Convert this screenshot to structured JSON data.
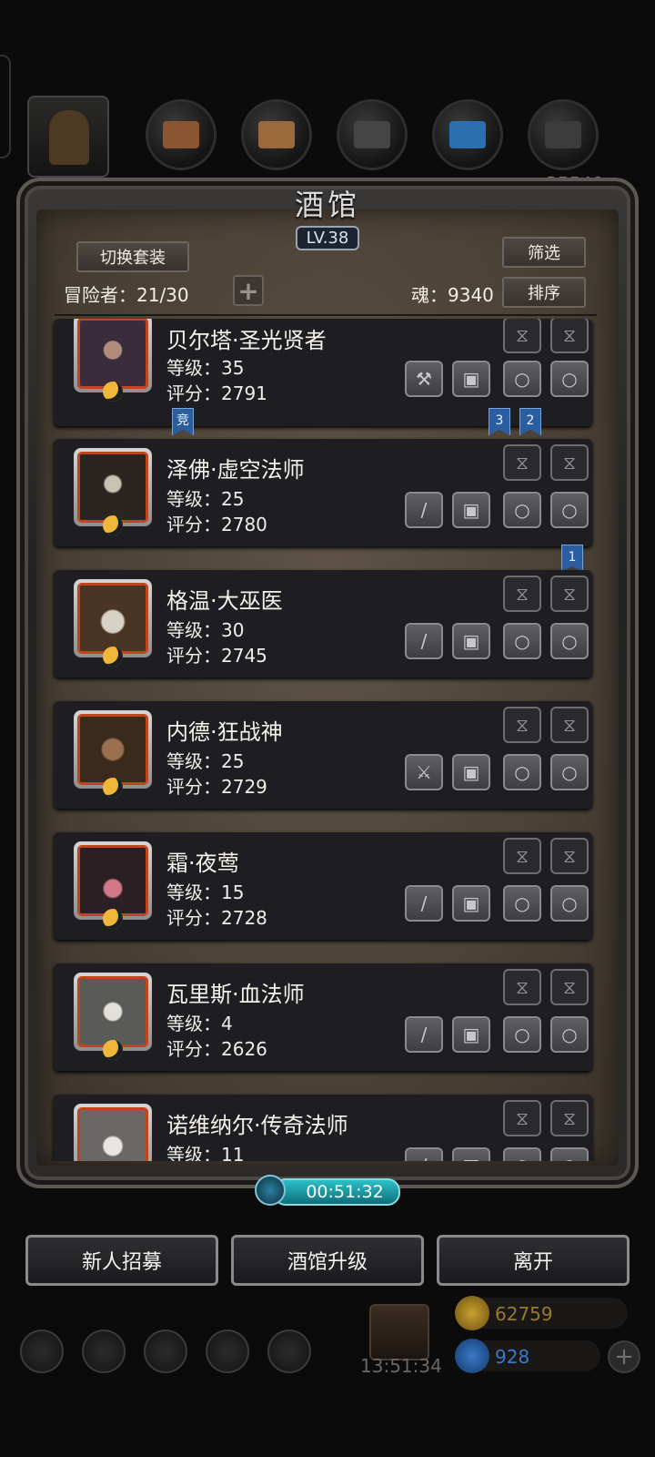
{
  "top_bar": {
    "hidden_value": "35540"
  },
  "panel": {
    "title": "酒馆",
    "level": "LV.38",
    "switch_set_label": "切换套装",
    "filter_label": "筛选",
    "sort_label": "排序",
    "adventurers_text": "冒险者：21/30",
    "soul_text": "魂：9340",
    "plus_symbol": "+"
  },
  "heroes": [
    {
      "name": "贝尔塔·圣光贤者",
      "level": "等级：35",
      "score": "评分：2791",
      "weapon_icon": "hammer-icon",
      "portrait_color": "#3a2b3d",
      "accent": "#b08d7a"
    },
    {
      "name": "泽佛·虚空法师",
      "level": "等级：25",
      "score": "评分：2780",
      "weapon_icon": "staff-icon",
      "portrait_color": "#2a2520",
      "accent": "#c9c2b4"
    },
    {
      "name": "格温·大巫医",
      "level": "等级：30",
      "score": "评分：2745",
      "weapon_icon": "staff-icon",
      "portrait_color": "#4a3524",
      "accent": "#d8d2c4"
    },
    {
      "name": "内德·狂战神",
      "level": "等级：25",
      "score": "评分：2729",
      "weapon_icon": "axe-icon",
      "portrait_color": "#3a2a1c",
      "accent": "#9a7050"
    },
    {
      "name": "霜·夜莺",
      "level": "等级：15",
      "score": "评分：2728",
      "weapon_icon": "dagger-icon",
      "portrait_color": "#2a1f22",
      "accent": "#d2788a"
    },
    {
      "name": "瓦里斯·血法师",
      "level": "等级：4",
      "score": "评分：2626",
      "weapon_icon": "staff-icon",
      "portrait_color": "#5a5a58",
      "accent": "#e4e1da"
    },
    {
      "name": "诺维纳尔·传奇法师",
      "level": "等级：11",
      "score": "",
      "weapon_icon": "staff-icon",
      "portrait_color": "#6a6866",
      "accent": "#e8e6e0"
    }
  ],
  "flags": {
    "arena": "竞",
    "rank3": "3",
    "rank2": "2",
    "rank1": "1"
  },
  "timer": "00:51:32",
  "buttons": {
    "recruit": "新人招募",
    "upgrade": "酒馆升级",
    "leave": "离开"
  },
  "hud": {
    "gift_timer": "13:51:34",
    "gold": "62759",
    "gems": "928",
    "add": "+"
  },
  "colors": {
    "gold": "#c9a030",
    "gem": "#3a78c8",
    "timer": "#2bc1c9"
  }
}
